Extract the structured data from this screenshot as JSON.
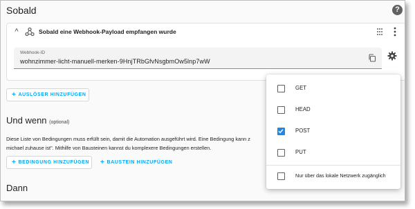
{
  "header": {
    "title": "Sobald",
    "help_icon": "help-circle-icon"
  },
  "trigger": {
    "title": "Sobald eine Webhook-Payload empfangen wurde",
    "icons": [
      "chevron-up-icon",
      "webhook-icon",
      "drag-icon",
      "kebab-menu-icon"
    ],
    "webhook_field": {
      "label": "Webhook-ID",
      "value": "wohnzimmer-licht-manuell-merken-9HnjTRbGfvNsgbmOw5lnp7wW",
      "icon": "copy-icon"
    },
    "settings_icon": "gear-icon"
  },
  "buttons": {
    "add_trigger": "AUSLÖSER HINZUFÜGEN",
    "add_condition": "BEDINGUNG HINZUFÜGEN",
    "add_block": "BAUSTEIN HINZUFÜGEN"
  },
  "conditions": {
    "title": "Und wenn",
    "optional": "(optional)",
    "description_line1": "Diese Liste von Bedingungen muss erfüllt sein, damit die Automation ausgeführt wird. Eine Bedingung kann z",
    "description_line2": "michael zuhause ist\". Mithilfe von Bausteinen kannst du komplexere Bedingungen erstellen."
  },
  "actions": {
    "title": "Dann"
  },
  "method_menu": {
    "items": [
      {
        "label": "GET",
        "checked": false
      },
      {
        "label": "HEAD",
        "checked": false
      },
      {
        "label": "POST",
        "checked": true
      },
      {
        "label": "PUT",
        "checked": false
      }
    ],
    "local_only": {
      "label": "Nur über das lokale Netzwerk zugänglich",
      "checked": false
    }
  },
  "colors": {
    "accent": "#03a9f4",
    "checkbox_checked": "#1e88e5"
  }
}
